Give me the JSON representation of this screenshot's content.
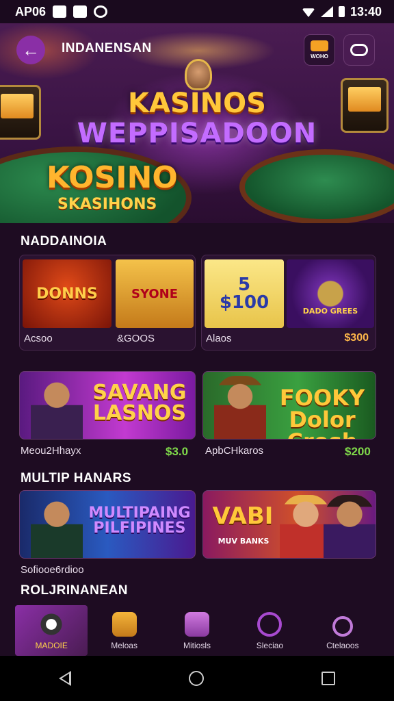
{
  "status_bar": {
    "left_text": "AP06",
    "time": "13:40"
  },
  "header": {
    "title": "INDANENSAN",
    "wallet_label": "WOHO"
  },
  "hero": {
    "logo_line1": "KASINOS",
    "logo_line2": "WEPPISADOON",
    "logo2_line1": "KOSINO",
    "logo2_line2": "SKASIHONS"
  },
  "section1": {
    "title": "NADDAINOIA",
    "cards": [
      {
        "tile1": "DONNS",
        "tile2": "SYONE",
        "caption1": "Acsoo",
        "caption2": "&GOOS"
      },
      {
        "tile1": "5\n$100",
        "tile2": "DADO GREES",
        "caption": "Alaos",
        "price": "$300"
      }
    ]
  },
  "banners": [
    {
      "text": "SAVANG\nLASNOS",
      "caption": "Meou2Hhayx",
      "price": "$3.0"
    },
    {
      "text": "FOOKY\nDolor Crosh",
      "caption": "ApbCHkaros",
      "price": "$200"
    }
  ],
  "section2": {
    "title": "MULTIP HANARS",
    "banners": [
      {
        "text": "MULTIPAING\nPILFIPINES",
        "caption": "Sofiooe6rdioo"
      },
      {
        "text": "VABI",
        "subtext": "MUV BANKS"
      }
    ]
  },
  "section3": {
    "title": "ROLJRINANEAN"
  },
  "bottom_nav": [
    {
      "label": "MADOIE",
      "icon": "casino-chip-icon"
    },
    {
      "label": "Meloas",
      "icon": "wallet-icon"
    },
    {
      "label": "Mitiosls",
      "icon": "games-icon"
    },
    {
      "label": "Sleciao",
      "icon": "chat-icon"
    },
    {
      "label": "Ctelaoos",
      "icon": "search-icon"
    }
  ],
  "colors": {
    "background": "#1e0c22",
    "accent": "#8a2fa6",
    "gold": "#ffc83a",
    "green": "#7fd84a"
  }
}
